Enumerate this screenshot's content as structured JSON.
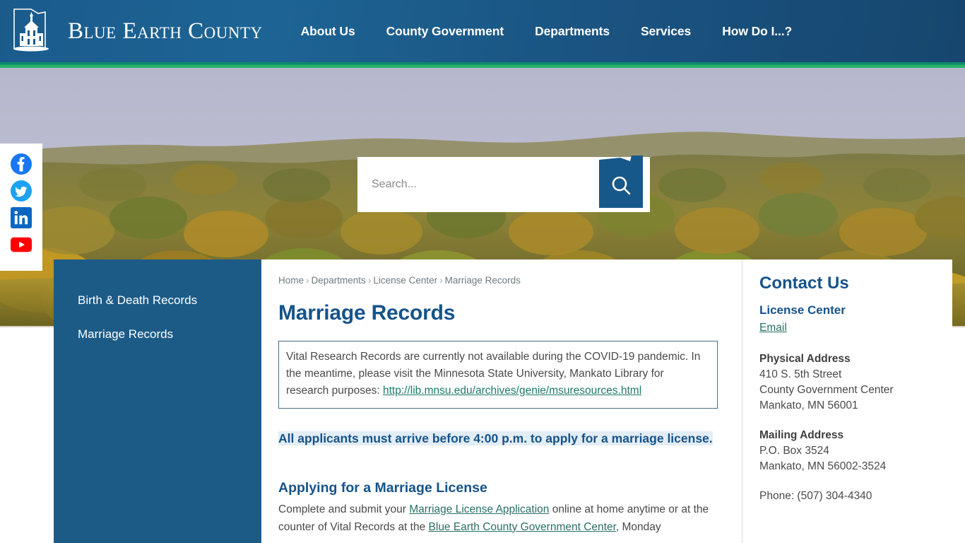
{
  "header": {
    "logo_icon": "county-courthouse-outline-icon",
    "site_title": "Blue Earth County",
    "nav": [
      {
        "label": "About Us"
      },
      {
        "label": "County Government"
      },
      {
        "label": "Departments"
      },
      {
        "label": "Services"
      },
      {
        "label": "How Do I...?"
      }
    ],
    "colors": {
      "header_blue": "#1a5b8c",
      "accent_teal": "#0e8a6c",
      "accent_green": "#27b36b"
    }
  },
  "social": [
    {
      "name": "facebook-icon",
      "color": "#1877F2"
    },
    {
      "name": "twitter-icon",
      "color": "#1DA1F2"
    },
    {
      "name": "linkedin-icon",
      "color": "#0A66C2"
    },
    {
      "name": "youtube-icon",
      "color": "#FF0000"
    }
  ],
  "search": {
    "placeholder": "Search...",
    "value": "",
    "button_icon": "search-icon",
    "button_color": "#17588a"
  },
  "sidebar": {
    "items": [
      {
        "label": "Birth & Death Records"
      },
      {
        "label": "Marriage Records"
      }
    ]
  },
  "breadcrumb": {
    "items": [
      {
        "label": "Home"
      },
      {
        "label": "Departments"
      },
      {
        "label": "License Center"
      },
      {
        "label": "Marriage Records"
      }
    ],
    "separator": "›"
  },
  "main": {
    "page_title": "Marriage Records",
    "notice": {
      "text_before": "Vital Research Records are currently not available during the COVID-19 pandemic.  In the meantime, please visit the Minnesota State University, Mankato Library for research purposes: ",
      "link_text": "http://lib.mnsu.edu/archives/genie/msuresources.html"
    },
    "alert": "All applicants must arrive before 4:00 p.m. to apply for a marriage license.",
    "section": {
      "heading": "Applying for a Marriage License",
      "part1": "Complete and submit your ",
      "link1": "Marriage License Application",
      "part2": " online at home anytime or at the counter of Vital Records at the ",
      "link2": "Blue Earth County Government Center",
      "part3": ", Monday"
    }
  },
  "contact": {
    "title": "Contact Us",
    "department": "License Center",
    "email_label": "Email",
    "physical_label": "Physical Address",
    "physical_lines": [
      "410 S. 5th Street",
      "County Government Center",
      "Mankato, MN 56001"
    ],
    "mailing_label": "Mailing Address",
    "mailing_lines": [
      "P.O. Box 3524",
      "Mankato, MN 56002-3524"
    ],
    "phone": "Phone: (507) 304-4340"
  }
}
